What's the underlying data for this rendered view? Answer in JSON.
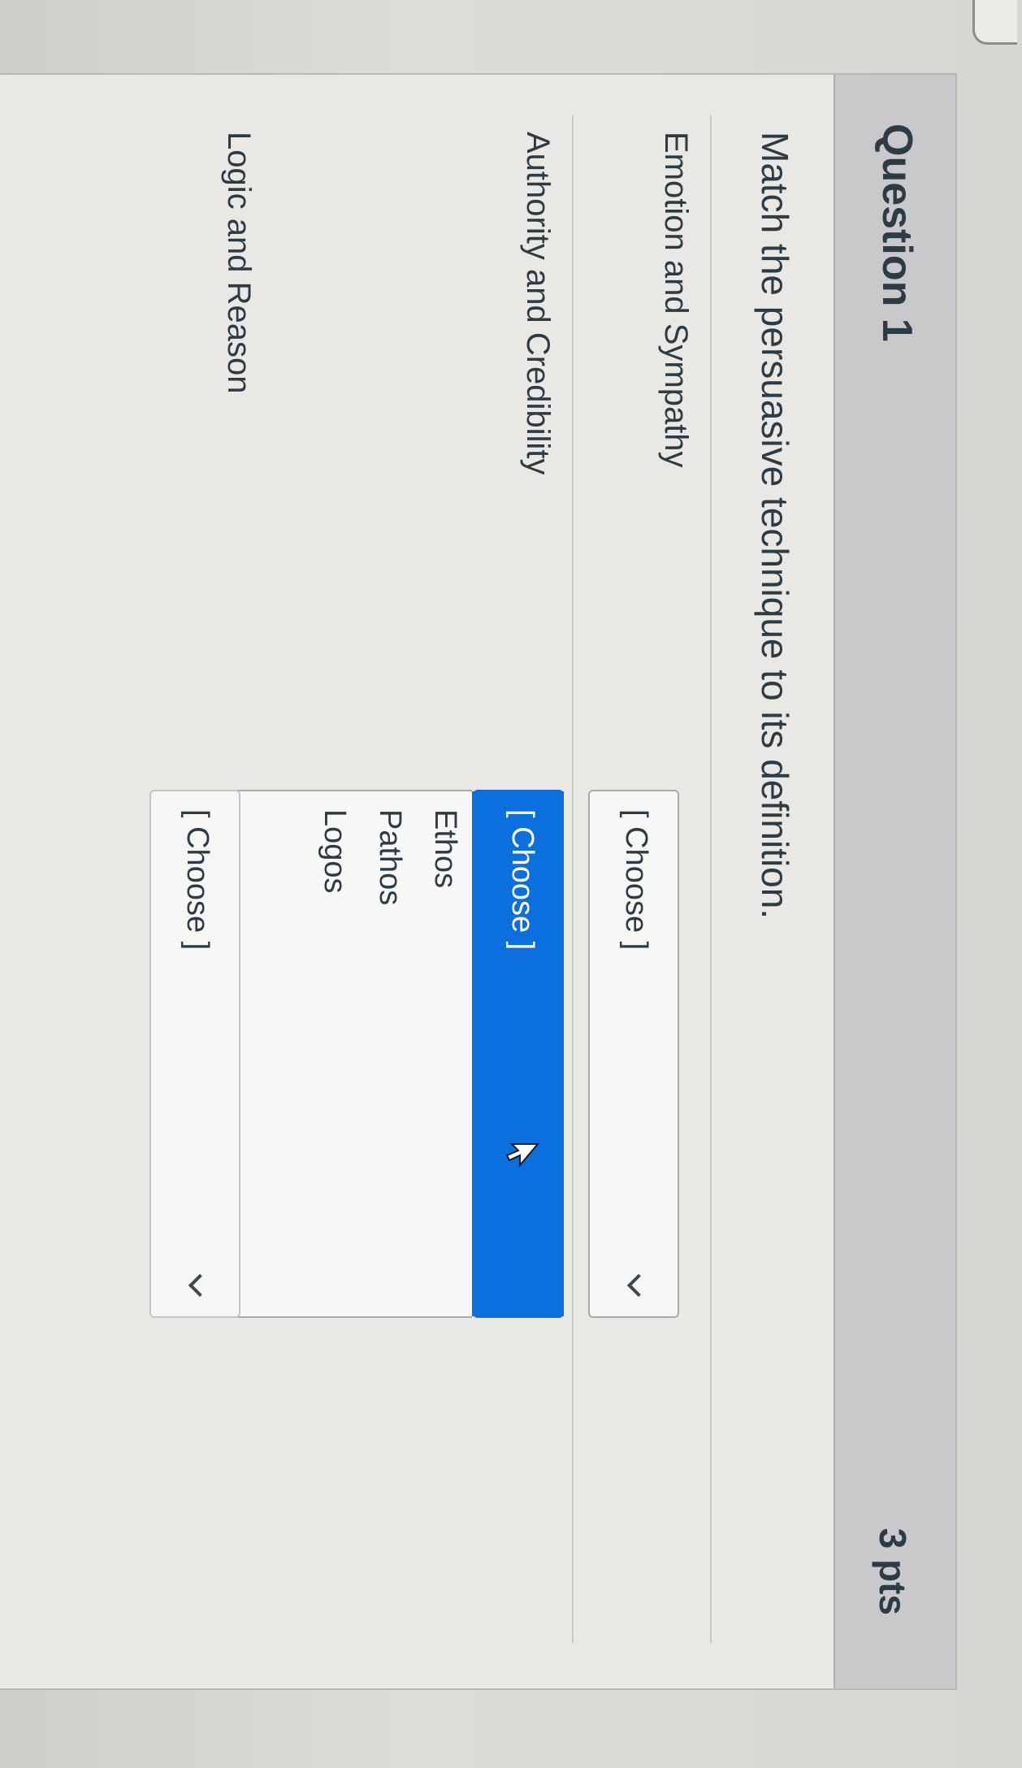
{
  "question": {
    "title": "Question 1",
    "points": "3 pts",
    "prompt": "Match the persuasive technique to its definition."
  },
  "rows": [
    {
      "label": "Emotion and Sympathy",
      "selected": "[ Choose ]"
    },
    {
      "label": "Authority and Credibility",
      "selected": "[ Choose ]"
    },
    {
      "label": "Logic and Reason",
      "selected": "[ Choose ]"
    }
  ],
  "dropdown": {
    "options": [
      "Ethos",
      "Pathos",
      "Logos",
      "[ Choose ]"
    ],
    "highlighted": "[ Choose ]"
  },
  "colors": {
    "highlight": "#0b6fdd",
    "header_bg": "#c9c9cb",
    "text": "#2d3b45"
  }
}
